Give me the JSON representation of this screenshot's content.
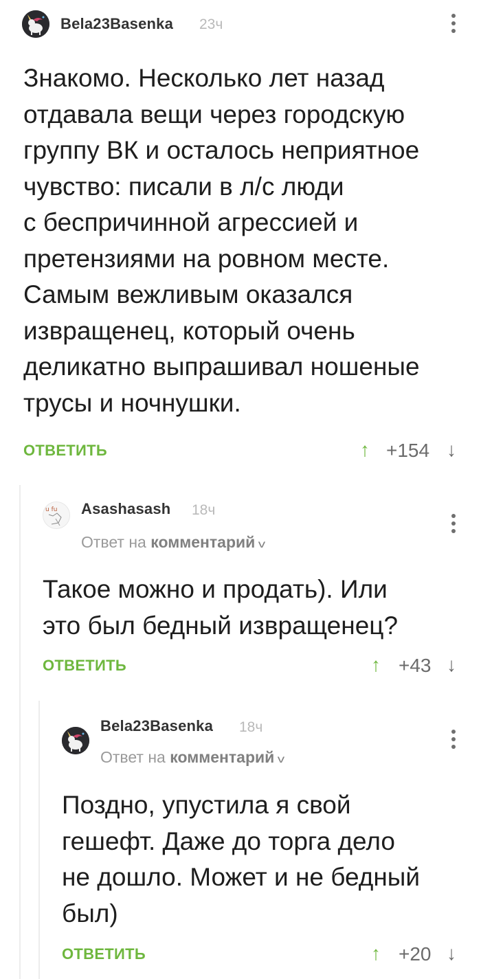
{
  "comments": [
    {
      "username": "Bela23Basenka",
      "time": "23ч",
      "text": "Знакомо. Несколько лет назад\nотдавала вещи через городскую\nгруппу ВК и осталось неприятное\nчувство: писали в л/с люди\nс беспричинной агрессией и\nпретензиями на ровном месте.\nСамым вежливым оказался\nизвращенец, который очень\nделикатно выпрашивал ношеные\nтрусы и ночнушки.",
      "reply_label": "ОТВЕТИТЬ",
      "rating": "+154",
      "avatar_icon": "unicorn-avatar-icon"
    },
    {
      "username": "Asashasash",
      "time": "18ч",
      "reply_prefix": "Ответ на",
      "reply_target": "комментарий",
      "text": "Такое можно и продать). Или\nэто был бедный извращенец?",
      "reply_label": "ОТВЕТИТЬ",
      "rating": "+43",
      "avatar_icon": "sketch-avatar-icon"
    },
    {
      "username": "Bela23Basenka",
      "time": "18ч",
      "reply_prefix": "Ответ на",
      "reply_target": "комментарий",
      "text": "Поздно, упустила я свой\nгешефт. Даже до торга дело\nне дошло. Может и не бедный\nбыл)",
      "reply_label": "ОТВЕТИТЬ",
      "rating": "+20",
      "avatar_icon": "unicorn-avatar-icon"
    }
  ],
  "colors": {
    "accent_green": "#6eb73e",
    "muted_gray": "#9a9a9a",
    "thread_line": "#ececec"
  }
}
